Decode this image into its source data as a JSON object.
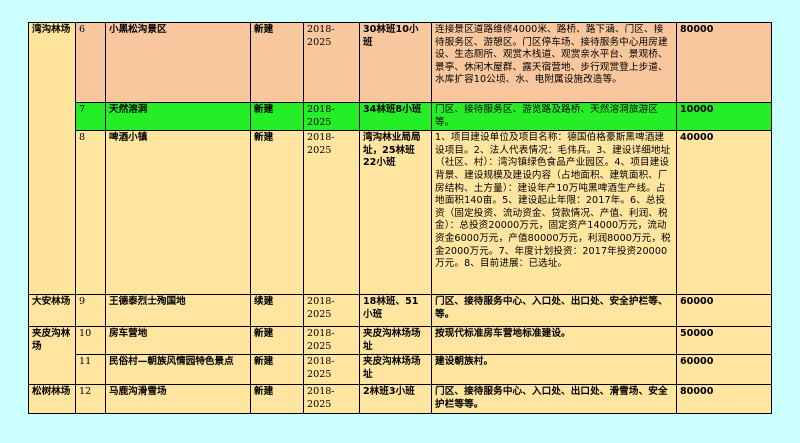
{
  "colors": {
    "page_bg": "#ccffff",
    "area_bg": "#ffe59c",
    "peach": "#f9c79e",
    "green": "#26ee26",
    "blank": "#ffffff",
    "gold": "#ffe5a0",
    "red_text": "#e60000"
  },
  "rows": [
    {
      "area": "湾沟林场",
      "num": "6",
      "name": "小黑松沟景区",
      "type": "新建",
      "period": "2018-2025",
      "location": "30林班10小班",
      "content": "连接景区道路维修4000米、路桥、路下涵、门区、接待服务区、游憩区。门区停车场、接待服务中心用房建设、生态厕所、观赏木栈道、观赏亲水平台、景观桥、景亭、休闲木屋群、露天宿营地、步行观赏登上步道、水库扩容10公顷、水、电附属设施改造等。",
      "investment": "80000"
    },
    {
      "area": "",
      "num": "7",
      "name": "天然溶洞",
      "type": "新建",
      "period": "2018-2025",
      "location": "34林班8小班",
      "content": "门区、接待服务区、游览路及路桥、天然溶洞旅游区等。",
      "investment": "10000"
    },
    {
      "area": "",
      "num": "8",
      "name": "啤酒小镇",
      "type": "新建",
      "period": "2018-2025",
      "location": "湾沟林业局局址，25林班22小班",
      "content": "1、项目建设单位及项目名称：德国伯格豪斯黑啤酒建设项目。2、法人代表情况：毛伟兵。3、建设详细地址（社区、村）：湾沟镇绿色食品产业园区。4、项目建设背景、建设规模及建设内容（占地面积、建筑面积、厂房结构、土方量）：建设年产10万吨黑啤酒生产线。占地面积140亩。5、建设起止年限：2017年。6、总投资（固定投资、流动资金、贷款情况、产值、利润、税金）：总投资20000万元，固定资产14000万元，流动资金6000万元，产值80000万元，利润8000万元，税金2000万元。7、年度计划投资：2017年投资20000万元。8、目前进展：已选址。",
      "investment": "40000"
    },
    {
      "area": "大安林场",
      "num": "9",
      "name": "王德泰烈士殉国地",
      "type": "续建",
      "period": "2018-2025",
      "location": "18林班、51小班",
      "content": "门区、接待服务中心、入口处、出口处、安全护栏等、等。",
      "investment": "60000"
    },
    {
      "area": "夹皮沟林场",
      "num": "10",
      "name": "房车营地",
      "type": "新建",
      "period": "2018-2025",
      "location": "夹皮沟林场场址",
      "content": "按现代标准房车营地标准建设。",
      "investment": "50000"
    },
    {
      "area": "",
      "num": "11",
      "name": "民俗村—朝族风情园特色景点",
      "type": "新建",
      "period": "2018-2025",
      "location": "夹皮沟林场场址",
      "content": "建设朝族村。",
      "investment": "60000"
    },
    {
      "area": "松树林场",
      "num": "12",
      "name": "马鹿沟滑雪场",
      "type": "新建",
      "period": "2018-2025",
      "location": "2林班3小班",
      "content": "门区、接待服务中心、入口处、出口处、滑雪场、安全护栏等等。",
      "investment": "80000"
    }
  ]
}
